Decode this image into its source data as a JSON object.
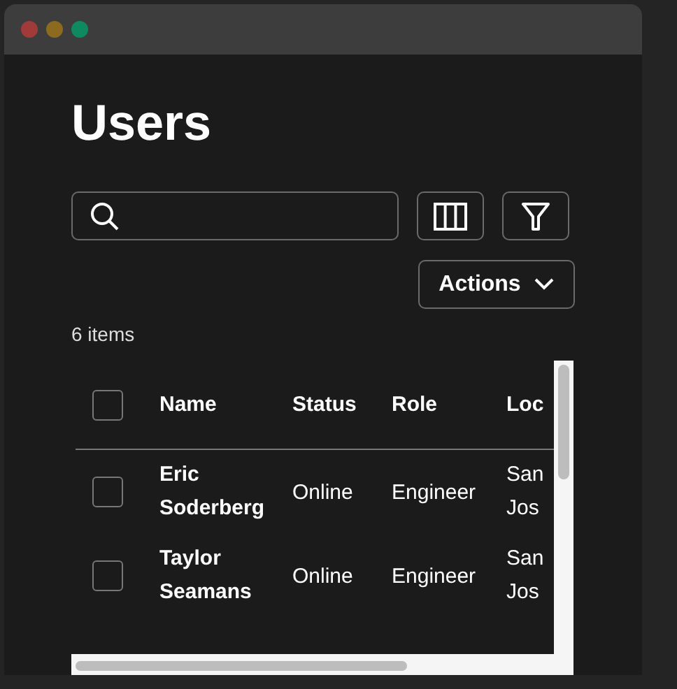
{
  "window": {
    "controls": [
      {
        "color": "#a33a3a"
      },
      {
        "color": "#8c6b1f"
      },
      {
        "color": "#0e8a60"
      }
    ]
  },
  "title": "Users",
  "toolbar": {
    "actions": "Actions"
  },
  "count": "6 items",
  "table": {
    "select_all": {
      "checked": false
    },
    "columns": [
      "Name",
      "Status",
      "Role",
      "Loc"
    ],
    "rows": [
      {
        "selected": false,
        "name": "Eric Soderberg",
        "status": "Online",
        "role": "Engineer",
        "location": "San Jos"
      },
      {
        "selected": false,
        "name": "Taylor Seamans",
        "status": "Online",
        "role": "Engineer",
        "location": "San Jos"
      }
    ]
  }
}
